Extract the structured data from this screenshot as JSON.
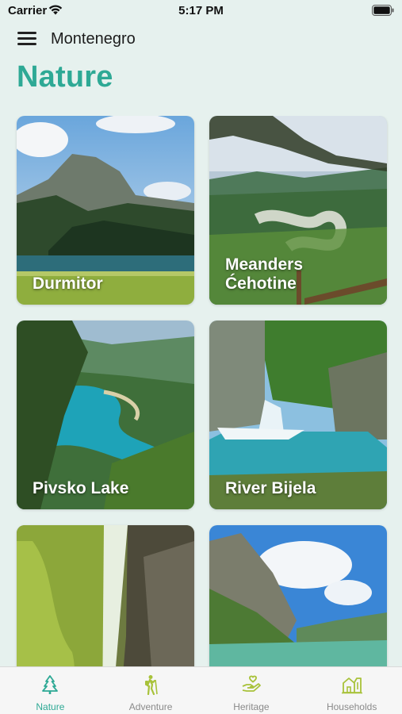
{
  "status_bar": {
    "carrier": "Carrier",
    "time": "5:17 PM"
  },
  "nav": {
    "title": "Montenegro"
  },
  "page": {
    "title": "Nature"
  },
  "cards": [
    {
      "label": "Durmitor"
    },
    {
      "label": "Meanders Ćehotine"
    },
    {
      "label": "Pivsko Lake"
    },
    {
      "label": "River Bijela"
    },
    {
      "label": ""
    },
    {
      "label": ""
    }
  ],
  "tabs": [
    {
      "label": "Nature",
      "icon": "tree-icon",
      "active": true
    },
    {
      "label": "Adventure",
      "icon": "hiker-icon",
      "active": false
    },
    {
      "label": "Heritage",
      "icon": "hand-heart-icon",
      "active": false
    },
    {
      "label": "Households",
      "icon": "houses-icon",
      "active": false
    }
  ],
  "colors": {
    "accent": "#2ea995",
    "background": "#e6f1ee",
    "tab_inactive": "#8a8a8a",
    "tab_icon_inactive": "#a8c23a"
  }
}
